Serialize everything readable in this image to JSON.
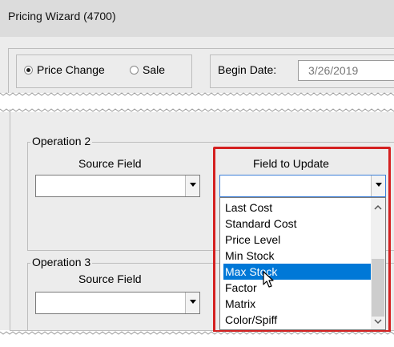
{
  "window": {
    "title": "Pricing Wizard (4700)"
  },
  "top": {
    "radio_price_change": "Price Change",
    "radio_sale": "Sale",
    "begin_date_label": "Begin Date:",
    "begin_date_value": "3/26/2019"
  },
  "operation2": {
    "label": "Operation 2",
    "source_field_label": "Source Field",
    "field_to_update_label": "Field to Update",
    "source_field_value": "",
    "field_to_update_value": ""
  },
  "operation3": {
    "label": "Operation 3",
    "source_field_label": "Source Field",
    "source_field_value": ""
  },
  "dropdown": {
    "items": [
      "Last Cost",
      "Standard Cost",
      "Price Level",
      "Min Stock",
      "Max Stock",
      "Factor",
      "Matrix",
      "Color/Spiff"
    ],
    "selected": "Max Stock"
  },
  "colors": {
    "highlight": "#d42020",
    "selection": "#0078d7"
  }
}
